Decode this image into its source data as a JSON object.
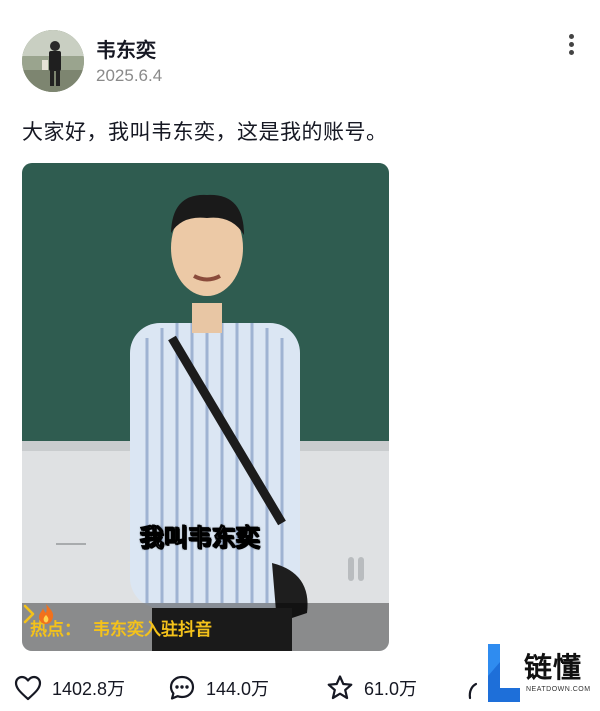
{
  "post": {
    "author": "韦东奕",
    "date": "2025.6.4",
    "text": "大家好，我叫韦东奕，这是我的账号。"
  },
  "media": {
    "caption": "我叫韦东奕",
    "hot_label": "热点：",
    "hot_text": "韦东奕入驻抖音",
    "accent_color": "#f4c21a"
  },
  "actions": {
    "likes": "1402.8万",
    "comments": "144.0万",
    "favorites": "61.0万"
  },
  "watermark": {
    "brand_cn": "链懂",
    "brand_en": "NEATDOWN.COM"
  },
  "icons": [
    "more-vertical-icon",
    "heart-icon",
    "comment-icon",
    "star-icon",
    "share-icon",
    "flame-icon",
    "chevron-right-icon"
  ]
}
